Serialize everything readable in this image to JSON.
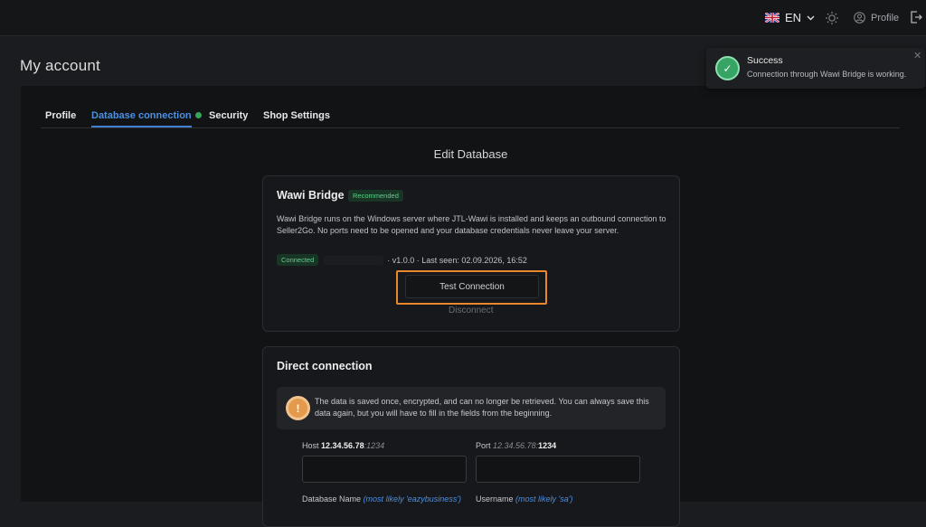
{
  "header": {
    "language": "EN",
    "profile_label": "Profile"
  },
  "page": {
    "title": "My account"
  },
  "tabs": [
    {
      "label": "Profile"
    },
    {
      "label": "Database connection"
    },
    {
      "label": "Security"
    },
    {
      "label": "Shop Settings"
    }
  ],
  "section_title": "Edit Database",
  "wawi_bridge": {
    "title": "Wawi Bridge",
    "badge": "Recommended",
    "description": "Wawi Bridge runs on the Windows server where JTL-Wawi is installed and keeps an outbound connection to Seller2Go. No ports need to be opened and your database credentials never leave your server.",
    "status": "Connected",
    "version_info": "· v1.0.0 · Last seen: 02.09.2026, 16:52",
    "test_button": "Test Connection",
    "disconnect": "Disconnect"
  },
  "direct_connection": {
    "title": "Direct connection",
    "warning": "The data is saved once, encrypted, and can no longer be retrieved. You can always save this data again, but you will have to fill in the fields from the beginning.",
    "host_label": "Host",
    "host_example": "12.34.56.78",
    "host_port_hint": ":1234",
    "port_label": "Port",
    "port_example_host": "12.34.56.78:",
    "port_example": "1234",
    "dbname_label": "Database Name",
    "dbname_hint": "(most likely 'eazybusiness')",
    "username_label": "Username",
    "username_hint": "(most likely 'sa')"
  },
  "toast": {
    "title": "Success",
    "message": "Connection through Wawi Bridge is working."
  },
  "colors": {
    "accent": "#3f7fd4",
    "success": "#36a463",
    "warning": "#e39a4a",
    "highlight": "#e8872c"
  }
}
